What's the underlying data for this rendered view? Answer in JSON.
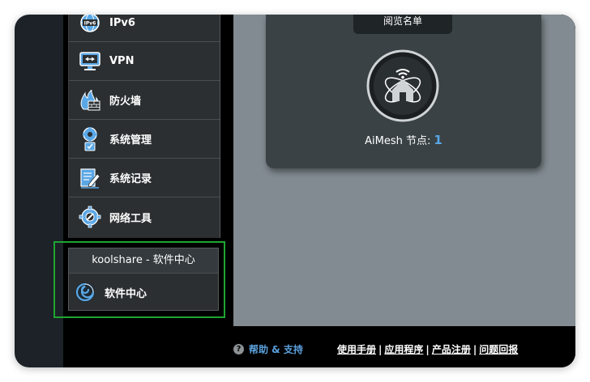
{
  "sidebar": {
    "items": [
      {
        "label": "IPv6",
        "icon": "ipv6-globe-icon"
      },
      {
        "label": "VPN",
        "icon": "vpn-monitor-icon"
      },
      {
        "label": "防火墙",
        "icon": "firewall-icon"
      },
      {
        "label": "系统管理",
        "icon": "system-admin-gear-icon"
      },
      {
        "label": "系统记录",
        "icon": "system-log-icon"
      },
      {
        "label": "网络工具",
        "icon": "network-tools-icon"
      }
    ]
  },
  "plugins": {
    "header": "koolshare - 软件中心",
    "item_label": "软件中心",
    "icon": "software-center-swirl-icon"
  },
  "card": {
    "button_label": "阅览名单",
    "aimesh_label": "AiMesh 节点:",
    "aimesh_count": "1"
  },
  "footer": {
    "help_label": "帮助 & 支持",
    "links": [
      "使用手册",
      "应用程序",
      "产品注册",
      "问题回报"
    ]
  },
  "colors": {
    "accent": "#5aa7e6",
    "highlight": "#1ea532",
    "sidebar_bg": "#2b2f31",
    "main_bg": "#818b91"
  }
}
